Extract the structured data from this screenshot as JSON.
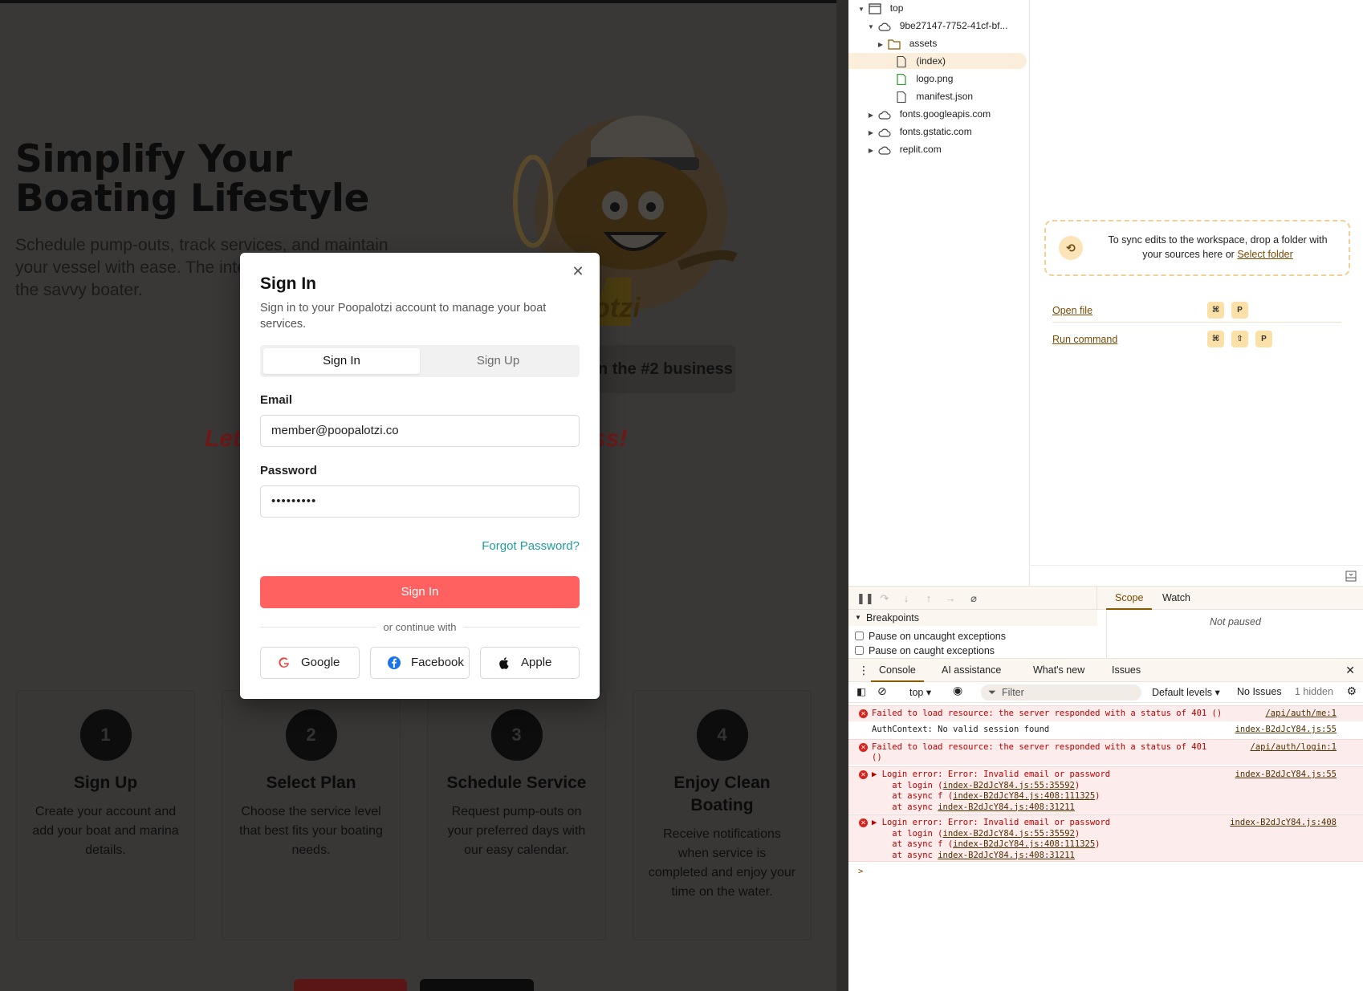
{
  "app": {
    "hero_title_line1": "Simplify Your",
    "hero_title_line2": "Boating Lifestyle",
    "hero_subtitle": "Schedule pump-outs, track services, and maintain your vessel with ease. The inte",
    "hero_subtitle_line3": "the savvy boater.",
    "mascot_text": "palotzi",
    "pill_text": "n the #2 business",
    "lets_left": "Let",
    "lets_right": "ss!",
    "steps": [
      {
        "num": "1",
        "title": "Sign Up",
        "desc": "Create your account and add your boat and marina details."
      },
      {
        "num": "2",
        "title": "Select Plan",
        "desc": "Choose the service level that best fits your boating needs."
      },
      {
        "num": "3",
        "title": "Schedule Service",
        "desc": "Request pump-outs on your preferred days with our easy calendar."
      },
      {
        "num": "4",
        "title": "Enjoy Clean Boating",
        "desc": "Receive notifications when service is completed and enjoy your time on the water."
      }
    ]
  },
  "modal": {
    "title": "Sign In",
    "description": "Sign in to your Poopalotzi account to manage your boat services.",
    "tabs": [
      "Sign In",
      "Sign Up"
    ],
    "email_label": "Email",
    "email_value": "member@poopalotzi.co",
    "password_label": "Password",
    "password_value": "•••••••••",
    "forgot": "Forgot Password?",
    "submit": "Sign In",
    "divider": "or continue with",
    "social": [
      "Google",
      "Facebook",
      "Apple"
    ],
    "accent": "#ff6161"
  },
  "devtools": {
    "tree": [
      {
        "label": "top",
        "icon": "frame-icon",
        "arrow": "down"
      },
      {
        "label": "9be27147-7752-41cf-bf...",
        "icon": "cloud-icon",
        "arrow": "down"
      },
      {
        "label": "assets",
        "icon": "folder-icon",
        "arrow": "right"
      },
      {
        "label": "(index)",
        "icon": "file-icon",
        "arrow": ""
      },
      {
        "label": "logo.png",
        "icon": "image-file-icon",
        "arrow": ""
      },
      {
        "label": "manifest.json",
        "icon": "file-icon",
        "arrow": ""
      },
      {
        "label": "fonts.googleapis.com",
        "icon": "cloud-icon",
        "arrow": "right"
      },
      {
        "label": "fonts.gstatic.com",
        "icon": "cloud-icon",
        "arrow": "right"
      },
      {
        "label": "replit.com",
        "icon": "cloud-icon",
        "arrow": "right"
      }
    ],
    "sync_text": "To sync edits to the workspace, drop a folder with your sources here or",
    "sync_link": "Select folder",
    "open_file": "Open file",
    "run_command": "Run command",
    "kbd_cmd": "⌘",
    "kbd_shift": "⇧",
    "kbd_p": "P",
    "scope_tab": "Scope",
    "watch_tab": "Watch",
    "breakpoints": "Breakpoints",
    "pause_uncaught": "Pause on uncaught exceptions",
    "pause_caught": "Pause on caught exceptions",
    "not_paused": "Not paused",
    "drawer_tabs": [
      "Console",
      "AI assistance",
      "What's new",
      "Issues"
    ],
    "context": "top",
    "filter": "Filter",
    "levels": "Default levels",
    "no_issues": "No Issues",
    "hidden": "1 hidden",
    "logs": [
      {
        "type": "err",
        "msg": "Failed to load resource: the server responded with a status of 401 ()",
        "src": "/api/auth/me:1"
      },
      {
        "type": "info",
        "msg": "AuthContext: No valid session found",
        "src": "index-B2dJcY84.js:55"
      },
      {
        "type": "err",
        "msg": "Failed to load resource: the server responded with a status of 401",
        "msg2": "()",
        "src": "/api/auth/login:1"
      },
      {
        "type": "err",
        "msg": "▶ Login error: Error: Invalid email or password",
        "src": "index-B2dJcY84.js:55",
        "stack": [
          [
            "    at login (",
            "index-B2dJcY84.js:55:35592",
            ")"
          ],
          [
            "    at async f (",
            "index-B2dJcY84.js:408:111325",
            ")"
          ],
          [
            "    at async ",
            "index-B2dJcY84.js:408:31211",
            ""
          ]
        ]
      },
      {
        "type": "err",
        "msg": "▶ Login error: Error: Invalid email or password",
        "src": "index-B2dJcY84.js:408",
        "stack": [
          [
            "    at login (",
            "index-B2dJcY84.js:55:35592",
            ")"
          ],
          [
            "    at async f (",
            "index-B2dJcY84.js:408:111325",
            ")"
          ],
          [
            "    at async ",
            "index-B2dJcY84.js:408:31211",
            ""
          ]
        ]
      }
    ],
    "prompt": ">"
  }
}
